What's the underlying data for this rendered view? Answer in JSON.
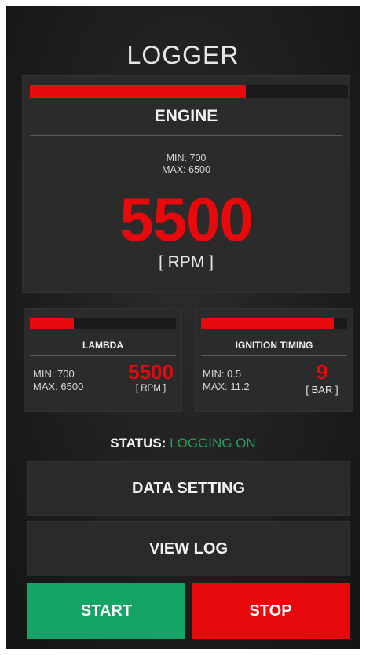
{
  "app": {
    "title": "LOGGER"
  },
  "engine": {
    "label": "ENGINE",
    "min": "MIN: 700",
    "max": "MAX: 6500",
    "value": "5500",
    "unit": "[ RPM ]",
    "level": 0.68
  },
  "lambda": {
    "label": "LAMBDA",
    "min": "MIN: 700",
    "max": "MAX: 6500",
    "value": "5500",
    "unit": "[ RPM ]",
    "level": 0.3
  },
  "ignition": {
    "label": "IGNITION TIMING",
    "min": "MIN: 0.5",
    "max": "MAX: 11.2",
    "value": "9",
    "unit": "[ BAR ]",
    "level": 0.91
  },
  "status": {
    "label": "STATUS:",
    "value": "LOGGING ON"
  },
  "buttons": {
    "data_setting": "DATA SETTING",
    "view_log": "VIEW LOG",
    "start": "START",
    "stop": "STOP"
  },
  "colors": {
    "accent_red": "#e8090c",
    "start_green": "#13a466",
    "status_green": "#2a9d5c"
  }
}
